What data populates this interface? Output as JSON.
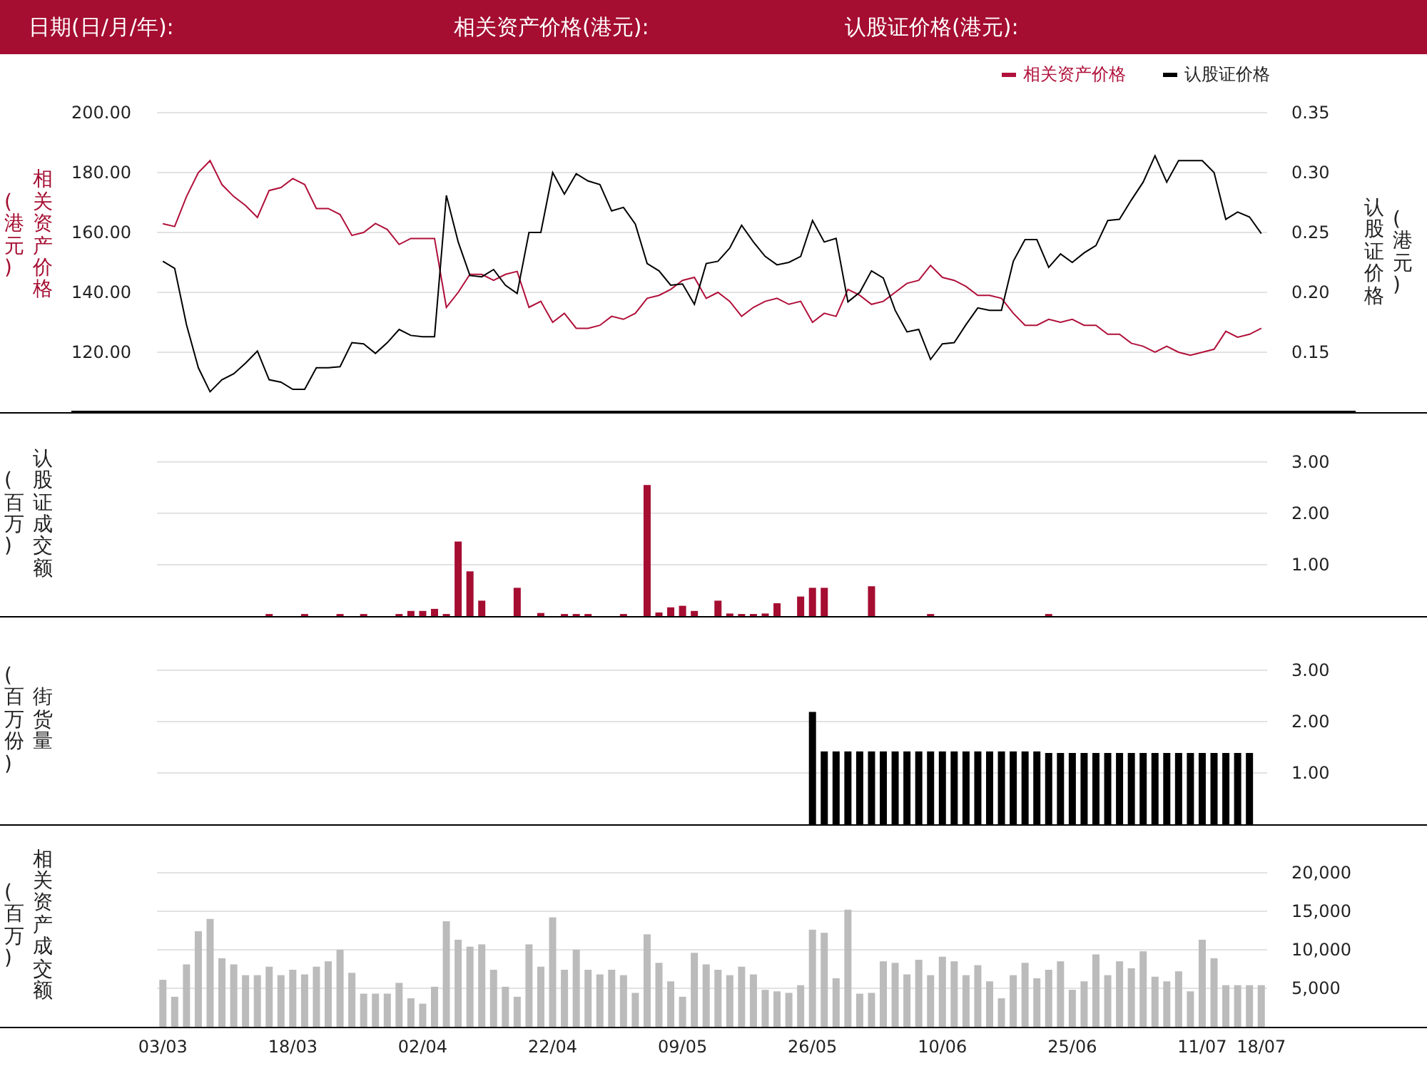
{
  "header": {
    "labels": [
      "日期(日/月/年):",
      "相关资产价格(港元):",
      "认股证价格(港元):"
    ]
  },
  "panels": [
    {
      "left_axis": {
        "title": "相关资产价格",
        "unit": "(港元)",
        "color": "#a50d31"
      },
      "right_axis": {
        "title": "认股证价格",
        "unit": "(港元)",
        "color": "#222222"
      },
      "chart_data": {
        "type": "line",
        "grid": true,
        "legend": "upper right",
        "ylim": [
          100,
          200
        ],
        "y2lim": [
          0.1,
          0.35
        ],
        "yticks": [
          {
            "value": 120,
            "label": "120.00"
          },
          {
            "value": 140,
            "label": "140.00"
          },
          {
            "value": 160,
            "label": "160.00"
          },
          {
            "value": 180,
            "label": "180.00"
          },
          {
            "value": 200,
            "label": "200.00"
          }
        ],
        "y2ticks": [
          {
            "value": 0.15,
            "label": "0.15"
          },
          {
            "value": 0.2,
            "label": "0.20"
          },
          {
            "value": 0.25,
            "label": "0.25"
          },
          {
            "value": 0.3,
            "label": "0.30"
          },
          {
            "value": 0.35,
            "label": "0.35"
          }
        ],
        "categories": [
          null,
          null,
          null,
          null,
          null,
          null,
          null,
          null,
          null,
          null,
          null,
          null,
          null,
          null,
          null,
          null,
          null,
          null,
          null,
          null,
          null,
          null,
          null,
          null,
          null,
          null,
          null,
          null,
          null,
          null,
          null,
          null,
          null,
          null,
          null,
          null,
          null,
          null,
          null,
          null,
          null,
          null,
          null,
          null,
          null,
          null,
          null,
          null,
          null,
          null,
          null,
          null,
          null,
          null,
          null,
          null,
          null,
          null,
          null,
          null,
          null,
          null,
          null,
          null,
          null,
          null,
          null,
          null,
          null,
          null,
          null,
          null,
          null,
          null,
          null,
          null,
          null,
          null,
          null,
          null,
          null,
          null,
          null,
          null,
          null,
          null,
          null,
          null,
          null,
          null,
          null,
          null,
          null,
          null
        ],
        "series": [
          {
            "name": "相关资产价格",
            "color": "#b0103a",
            "values": [
              162.9,
              162,
              172,
              180,
              184,
              176,
              172,
              169,
              165,
              174,
              175,
              178,
              176,
              168,
              168,
              166,
              159,
              160,
              163,
              161,
              156,
              158,
              158,
              158,
              135,
              140,
              146,
              146,
              144,
              146,
              147,
              135,
              137,
              130,
              133,
              128,
              128,
              129,
              132,
              131,
              133,
              138,
              139,
              141,
              144,
              145,
              138,
              140,
              137,
              132,
              135,
              137,
              138,
              136,
              137,
              130,
              133,
              132,
              141,
              139,
              136,
              137,
              140,
              143,
              144,
              149,
              145,
              144,
              142,
              139,
              139,
              138,
              133,
              129,
              129,
              131,
              130,
              131,
              129,
              129,
              126,
              126,
              123,
              122,
              120,
              122,
              120,
              119,
              120,
              121,
              127,
              125,
              126,
              128
            ]
          },
          {
            "name": "认股证价格",
            "color": "#000000",
            "axis": "y2",
            "values": [
              0.226,
              0.22,
              0.173,
              0.137,
              0.117,
              0.127,
              0.132,
              0.141,
              0.151,
              0.127,
              0.125,
              0.119,
              0.119,
              0.137,
              0.137,
              0.138,
              0.158,
              0.157,
              0.149,
              0.158,
              0.169,
              0.164,
              0.163,
              0.163,
              0.281,
              0.242,
              0.214,
              0.213,
              0.219,
              0.206,
              0.199,
              0.25,
              0.25,
              0.3,
              0.282,
              0.299,
              0.293,
              0.29,
              0.268,
              0.271,
              0.257,
              0.224,
              0.218,
              0.206,
              0.207,
              0.19,
              0.224,
              0.226,
              0.237,
              0.256,
              0.242,
              0.23,
              0.223,
              0.225,
              0.23,
              0.26,
              0.242,
              0.245,
              0.192,
              0.2,
              0.218,
              0.212,
              0.185,
              0.167,
              0.169,
              0.144,
              0.157,
              0.158,
              0.173,
              0.187,
              0.185,
              0.185,
              0.226,
              0.244,
              0.244,
              0.221,
              0.232,
              0.225,
              0.233,
              0.239,
              0.26,
              0.261,
              0.277,
              0.292,
              0.314,
              0.292,
              0.31,
              0.31,
              0.31,
              0.3,
              0.261,
              0.267,
              0.263,
              0.249
            ]
          }
        ]
      }
    },
    {
      "left_axis": {
        "unit": "(百万)",
        "color": "#222222"
      },
      "chart_data": {
        "type": "bar",
        "grid": true,
        "ylim": [
          0,
          3.94
        ],
        "yticks": [
          {
            "value": 1,
            "label": "1.00"
          },
          {
            "value": 2,
            "label": "2.00"
          },
          {
            "value": 3,
            "label": "3.00"
          }
        ],
        "categories": [
          null,
          null,
          null,
          null,
          null,
          null,
          null,
          null,
          null,
          null,
          null,
          null,
          null,
          null,
          null,
          null,
          null,
          null,
          null,
          null,
          null,
          null,
          null,
          null,
          null,
          null,
          null,
          null,
          null,
          null,
          null,
          null,
          null,
          null,
          null,
          null,
          null,
          null,
          null,
          null,
          null,
          null,
          null,
          null,
          null,
          null,
          null,
          null,
          null,
          null,
          null,
          null,
          null,
          null,
          null,
          null,
          null,
          null,
          null,
          null,
          null,
          null,
          null,
          null,
          null,
          null,
          null,
          null,
          null,
          null,
          null,
          null,
          null,
          null,
          null,
          null,
          null,
          null,
          null,
          null,
          null,
          null,
          null,
          null,
          null,
          null,
          null,
          null,
          null,
          null,
          null,
          null,
          null,
          null
        ],
        "series": [
          {
            "name": "认股证成交额",
            "color": "#a50d31",
            "values": [
              null,
              null,
              null,
              null,
              null,
              null,
              null,
              null,
              null,
              0.04,
              null,
              null,
              0.04,
              null,
              null,
              0.04,
              null,
              0.04,
              null,
              null,
              0.04,
              0.1,
              0.1,
              0.14,
              0.04,
              1.45,
              0.87,
              0.3,
              null,
              null,
              0.55,
              null,
              0.06,
              null,
              0.04,
              0.04,
              0.04,
              null,
              null,
              0.04,
              null,
              2.55,
              0.07,
              0.17,
              0.2,
              0.1,
              null,
              0.3,
              0.05,
              0.04,
              0.04,
              0.05,
              0.25,
              null,
              0.38,
              0.55,
              0.55,
              null,
              null,
              null,
              0.58,
              null,
              null,
              null,
              null,
              0.04,
              null,
              null,
              null,
              null,
              null,
              null,
              null,
              null,
              null,
              0.04,
              null,
              null,
              null,
              null,
              null,
              null,
              null,
              null,
              null,
              null,
              null,
              null,
              null,
              null,
              null,
              null,
              null,
              null
            ]
          }
        ]
      }
    },
    {
      "left_axis": {
        "unit": "(百万份)",
        "color": "#222222"
      },
      "chart_data": {
        "type": "bar",
        "grid": true,
        "ylim": [
          0,
          4.03
        ],
        "yticks": [
          {
            "value": 1,
            "label": "1.00"
          },
          {
            "value": 2,
            "label": "2.00"
          },
          {
            "value": 3,
            "label": "3.00"
          }
        ],
        "categories": [
          null,
          null,
          null,
          null,
          null,
          null,
          null,
          null,
          null,
          null,
          null,
          null,
          null,
          null,
          null,
          null,
          null,
          null,
          null,
          null,
          null,
          null,
          null,
          null,
          null,
          null,
          null,
          null,
          null,
          null,
          null,
          null,
          null,
          null,
          null,
          null,
          null,
          null,
          null,
          null,
          null,
          null,
          null,
          null,
          null,
          null,
          null,
          null,
          null,
          null,
          null,
          null,
          null,
          null,
          null,
          null,
          null,
          null,
          null,
          null,
          null,
          null,
          null,
          null,
          null,
          null,
          null,
          null,
          null,
          null,
          null,
          null,
          null,
          null,
          null,
          null,
          null,
          null,
          null,
          null,
          null,
          null,
          null,
          null,
          null,
          null,
          null,
          null,
          null,
          null,
          null,
          null,
          null,
          null
        ],
        "series": [
          {
            "name": "街货量",
            "color": "#000000",
            "values": [
              null,
              null,
              null,
              null,
              null,
              null,
              null,
              null,
              null,
              null,
              null,
              null,
              null,
              null,
              null,
              null,
              null,
              null,
              null,
              null,
              null,
              null,
              null,
              null,
              null,
              null,
              null,
              null,
              null,
              null,
              null,
              null,
              null,
              null,
              null,
              null,
              null,
              null,
              null,
              null,
              null,
              null,
              null,
              null,
              null,
              null,
              null,
              null,
              null,
              null,
              null,
              null,
              null,
              null,
              null,
              2.19,
              1.42,
              1.42,
              1.42,
              1.42,
              1.42,
              1.42,
              1.42,
              1.42,
              1.42,
              1.42,
              1.42,
              1.42,
              1.42,
              1.42,
              1.42,
              1.42,
              1.42,
              1.42,
              1.42,
              1.39,
              1.39,
              1.39,
              1.39,
              1.39,
              1.39,
              1.39,
              1.39,
              1.39,
              1.39,
              1.39,
              1.39,
              1.39,
              1.39,
              1.39,
              1.39,
              1.39,
              1.39,
              null
            ]
          }
        ]
      }
    },
    {
      "left_axis": {
        "unit": "(百万)",
        "color": "#222222"
      },
      "chart_data": {
        "type": "bar",
        "grid": true,
        "ylim": [
          0,
          26100
        ],
        "yticks": [
          {
            "value": 5000,
            "label": "5,000"
          },
          {
            "value": 10000,
            "label": "10,000"
          },
          {
            "value": 15000,
            "label": "15,000"
          },
          {
            "value": 20000,
            "label": "20,000"
          }
        ],
        "categories": [
          "03/03",
          null,
          null,
          null,
          null,
          null,
          null,
          null,
          null,
          null,
          null,
          "18/03",
          null,
          null,
          null,
          null,
          null,
          null,
          null,
          null,
          null,
          null,
          "02/04",
          null,
          null,
          null,
          null,
          null,
          null,
          null,
          null,
          null,
          null,
          "22/04",
          null,
          null,
          null,
          null,
          null,
          null,
          null,
          null,
          null,
          null,
          "09/05",
          null,
          null,
          null,
          null,
          null,
          null,
          null,
          null,
          null,
          null,
          "26/05",
          null,
          null,
          null,
          null,
          null,
          null,
          null,
          null,
          null,
          null,
          "10/06",
          null,
          null,
          null,
          null,
          null,
          null,
          null,
          null,
          null,
          null,
          "25/06",
          null,
          null,
          null,
          null,
          null,
          null,
          null,
          null,
          null,
          null,
          "11/07",
          null,
          null,
          null,
          null,
          "18/07"
        ],
        "series": [
          {
            "name": "相关资产成交额",
            "color": "#bbbbbb",
            "values": [
              6100,
              3900,
              8100,
              12400,
              14000,
              8900,
              8100,
              6700,
              6700,
              7800,
              6700,
              7400,
              6800,
              7800,
              8500,
              10000,
              7000,
              4300,
              4300,
              4300,
              5700,
              3700,
              3000,
              5200,
              13700,
              11300,
              10400,
              10700,
              7400,
              5200,
              3900,
              10700,
              7800,
              14200,
              7400,
              10000,
              7400,
              6800,
              7400,
              6700,
              4400,
              12000,
              8300,
              5900,
              3900,
              9600,
              8100,
              7400,
              6700,
              7800,
              6800,
              4800,
              4600,
              4400,
              5400,
              12600,
              12200,
              6300,
              15200,
              4300,
              4400,
              8500,
              8300,
              6800,
              8700,
              6700,
              9100,
              8500,
              6700,
              8000,
              5900,
              3700,
              6700,
              8300,
              6300,
              7400,
              8500,
              4800,
              5900,
              9400,
              6700,
              8500,
              7600,
              9800,
              6500,
              5900,
              7200,
              4600,
              11300,
              8900,
              5400,
              5400,
              5400,
              5400
            ]
          }
        ]
      }
    }
  ]
}
